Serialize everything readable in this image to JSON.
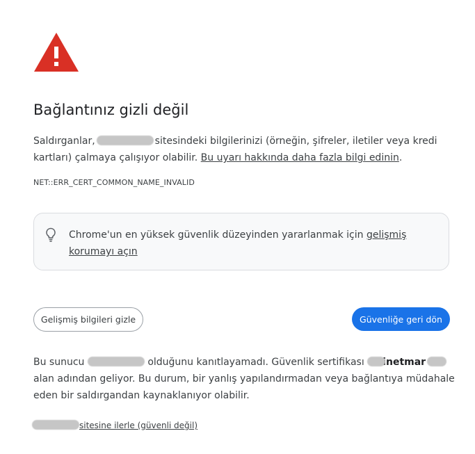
{
  "icon": "warning-triangle-icon",
  "colors": {
    "warning_red": "#d93025",
    "primary_blue": "#1a73e8",
    "tip_bg": "#f8f9fa",
    "redaction": "#c6c6c6"
  },
  "title": "Bağlantınız gizli değil",
  "intro": {
    "prefix": "Saldırganlar,",
    "suffix": "sitesindeki bilgilerinizi (örneğin, şifreler, iletiler veya kredi kartları) çalmaya çalışıyor olabilir.",
    "learn_more_link": "Bu uyarı hakkında daha fazla bilgi edinin",
    "period": "."
  },
  "error_code": "NET::ERR_CERT_COMMON_NAME_INVALID",
  "tip": {
    "icon": "lightbulb-icon",
    "text": "Chrome'un en yüksek güvenlik düzeyinden yararlanmak için",
    "link": "gelişmiş korumayı açın"
  },
  "buttons": {
    "advanced": "Gelişmiş bilgileri gizle",
    "back_to_safety": "Güvenliğe geri dön"
  },
  "details": {
    "part1": "Bu sunucu",
    "part2": "olduğunu kanıtlayamadı. Güvenlik sertifikası",
    "issuer_visible": "inetmar",
    "part3": "alan adından geliyor. Bu durum, bir yanlış yapılandırmadan veya bağlantıya müdahale eden bir saldırgandan kaynaklanıyor olabilir."
  },
  "proceed": {
    "text": "sitesine ilerle (güvenli değil)"
  }
}
